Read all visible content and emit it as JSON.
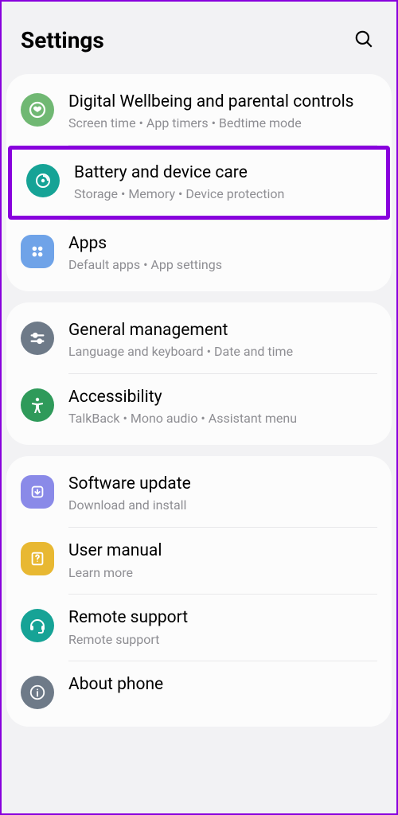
{
  "header": {
    "title": "Settings"
  },
  "groups": [
    {
      "items": [
        {
          "title": "Digital Wellbeing and parental controls",
          "sub": "Screen time  •  App timers  •  Bedtime mode"
        },
        {
          "title": "Battery and device care",
          "sub": "Storage  •  Memory  •  Device protection"
        },
        {
          "title": "Apps",
          "sub": "Default apps  •  App settings"
        }
      ]
    },
    {
      "items": [
        {
          "title": "General management",
          "sub": "Language and keyboard  •  Date and time"
        },
        {
          "title": "Accessibility",
          "sub": "TalkBack  •  Mono audio  •  Assistant menu"
        }
      ]
    },
    {
      "items": [
        {
          "title": "Software update",
          "sub": "Download and install"
        },
        {
          "title": "User manual",
          "sub": "Learn more"
        },
        {
          "title": "Remote support",
          "sub": "Remote support"
        },
        {
          "title": "About phone",
          "sub": ""
        }
      ]
    }
  ]
}
